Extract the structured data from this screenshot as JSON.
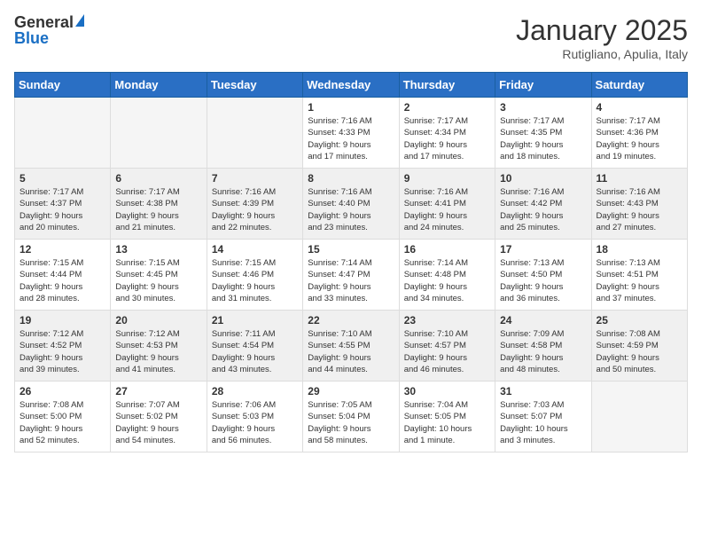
{
  "header": {
    "logo_general": "General",
    "logo_blue": "Blue",
    "month": "January 2025",
    "location": "Rutigliano, Apulia, Italy"
  },
  "weekdays": [
    "Sunday",
    "Monday",
    "Tuesday",
    "Wednesday",
    "Thursday",
    "Friday",
    "Saturday"
  ],
  "weeks": [
    {
      "shaded": false,
      "days": [
        {
          "num": "",
          "info": ""
        },
        {
          "num": "",
          "info": ""
        },
        {
          "num": "",
          "info": ""
        },
        {
          "num": "1",
          "info": "Sunrise: 7:16 AM\nSunset: 4:33 PM\nDaylight: 9 hours\nand 17 minutes."
        },
        {
          "num": "2",
          "info": "Sunrise: 7:17 AM\nSunset: 4:34 PM\nDaylight: 9 hours\nand 17 minutes."
        },
        {
          "num": "3",
          "info": "Sunrise: 7:17 AM\nSunset: 4:35 PM\nDaylight: 9 hours\nand 18 minutes."
        },
        {
          "num": "4",
          "info": "Sunrise: 7:17 AM\nSunset: 4:36 PM\nDaylight: 9 hours\nand 19 minutes."
        }
      ]
    },
    {
      "shaded": true,
      "days": [
        {
          "num": "5",
          "info": "Sunrise: 7:17 AM\nSunset: 4:37 PM\nDaylight: 9 hours\nand 20 minutes."
        },
        {
          "num": "6",
          "info": "Sunrise: 7:17 AM\nSunset: 4:38 PM\nDaylight: 9 hours\nand 21 minutes."
        },
        {
          "num": "7",
          "info": "Sunrise: 7:16 AM\nSunset: 4:39 PM\nDaylight: 9 hours\nand 22 minutes."
        },
        {
          "num": "8",
          "info": "Sunrise: 7:16 AM\nSunset: 4:40 PM\nDaylight: 9 hours\nand 23 minutes."
        },
        {
          "num": "9",
          "info": "Sunrise: 7:16 AM\nSunset: 4:41 PM\nDaylight: 9 hours\nand 24 minutes."
        },
        {
          "num": "10",
          "info": "Sunrise: 7:16 AM\nSunset: 4:42 PM\nDaylight: 9 hours\nand 25 minutes."
        },
        {
          "num": "11",
          "info": "Sunrise: 7:16 AM\nSunset: 4:43 PM\nDaylight: 9 hours\nand 27 minutes."
        }
      ]
    },
    {
      "shaded": false,
      "days": [
        {
          "num": "12",
          "info": "Sunrise: 7:15 AM\nSunset: 4:44 PM\nDaylight: 9 hours\nand 28 minutes."
        },
        {
          "num": "13",
          "info": "Sunrise: 7:15 AM\nSunset: 4:45 PM\nDaylight: 9 hours\nand 30 minutes."
        },
        {
          "num": "14",
          "info": "Sunrise: 7:15 AM\nSunset: 4:46 PM\nDaylight: 9 hours\nand 31 minutes."
        },
        {
          "num": "15",
          "info": "Sunrise: 7:14 AM\nSunset: 4:47 PM\nDaylight: 9 hours\nand 33 minutes."
        },
        {
          "num": "16",
          "info": "Sunrise: 7:14 AM\nSunset: 4:48 PM\nDaylight: 9 hours\nand 34 minutes."
        },
        {
          "num": "17",
          "info": "Sunrise: 7:13 AM\nSunset: 4:50 PM\nDaylight: 9 hours\nand 36 minutes."
        },
        {
          "num": "18",
          "info": "Sunrise: 7:13 AM\nSunset: 4:51 PM\nDaylight: 9 hours\nand 37 minutes."
        }
      ]
    },
    {
      "shaded": true,
      "days": [
        {
          "num": "19",
          "info": "Sunrise: 7:12 AM\nSunset: 4:52 PM\nDaylight: 9 hours\nand 39 minutes."
        },
        {
          "num": "20",
          "info": "Sunrise: 7:12 AM\nSunset: 4:53 PM\nDaylight: 9 hours\nand 41 minutes."
        },
        {
          "num": "21",
          "info": "Sunrise: 7:11 AM\nSunset: 4:54 PM\nDaylight: 9 hours\nand 43 minutes."
        },
        {
          "num": "22",
          "info": "Sunrise: 7:10 AM\nSunset: 4:55 PM\nDaylight: 9 hours\nand 44 minutes."
        },
        {
          "num": "23",
          "info": "Sunrise: 7:10 AM\nSunset: 4:57 PM\nDaylight: 9 hours\nand 46 minutes."
        },
        {
          "num": "24",
          "info": "Sunrise: 7:09 AM\nSunset: 4:58 PM\nDaylight: 9 hours\nand 48 minutes."
        },
        {
          "num": "25",
          "info": "Sunrise: 7:08 AM\nSunset: 4:59 PM\nDaylight: 9 hours\nand 50 minutes."
        }
      ]
    },
    {
      "shaded": false,
      "days": [
        {
          "num": "26",
          "info": "Sunrise: 7:08 AM\nSunset: 5:00 PM\nDaylight: 9 hours\nand 52 minutes."
        },
        {
          "num": "27",
          "info": "Sunrise: 7:07 AM\nSunset: 5:02 PM\nDaylight: 9 hours\nand 54 minutes."
        },
        {
          "num": "28",
          "info": "Sunrise: 7:06 AM\nSunset: 5:03 PM\nDaylight: 9 hours\nand 56 minutes."
        },
        {
          "num": "29",
          "info": "Sunrise: 7:05 AM\nSunset: 5:04 PM\nDaylight: 9 hours\nand 58 minutes."
        },
        {
          "num": "30",
          "info": "Sunrise: 7:04 AM\nSunset: 5:05 PM\nDaylight: 10 hours\nand 1 minute."
        },
        {
          "num": "31",
          "info": "Sunrise: 7:03 AM\nSunset: 5:07 PM\nDaylight: 10 hours\nand 3 minutes."
        },
        {
          "num": "",
          "info": ""
        }
      ]
    }
  ]
}
